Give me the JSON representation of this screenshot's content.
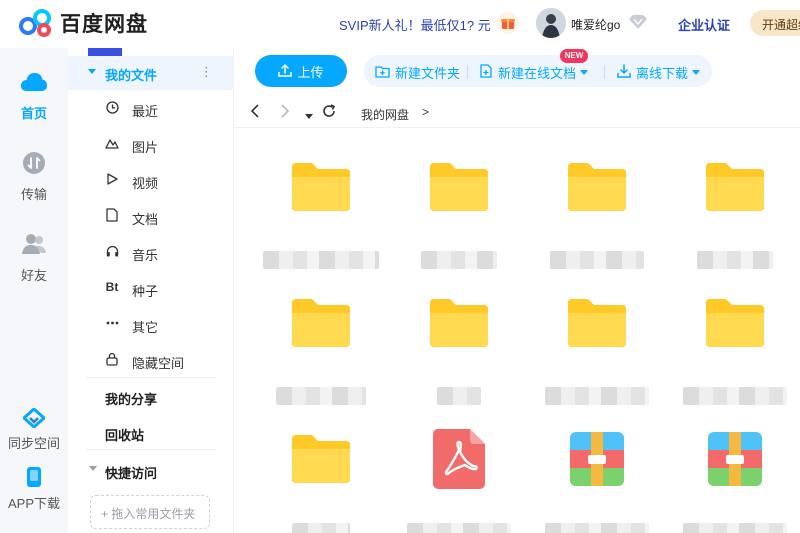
{
  "app": {
    "title": "百度网盘"
  },
  "topbar": {
    "promo": "SVIP新人礼！最低仅1? 元",
    "username": "唯爱纶go",
    "enterprise": "企业认证",
    "svip_button": "开通超级"
  },
  "rail": {
    "items": [
      {
        "label": "首页",
        "icon": "cloud-icon",
        "active": true
      },
      {
        "label": "传输",
        "icon": "transfer-icon",
        "active": false
      },
      {
        "label": "好友",
        "icon": "friends-icon",
        "active": false
      },
      {
        "label": "同步空间",
        "icon": "sync-icon",
        "active": false
      },
      {
        "label": "APP下载",
        "icon": "phone-icon",
        "active": false
      }
    ]
  },
  "sidebar": {
    "my_files": "我的文件",
    "items": [
      {
        "label": "最近",
        "icon": "clock-icon"
      },
      {
        "label": "图片",
        "icon": "image-icon"
      },
      {
        "label": "视频",
        "icon": "play-icon"
      },
      {
        "label": "文档",
        "icon": "document-icon"
      },
      {
        "label": "音乐",
        "icon": "headphones-icon"
      },
      {
        "label": "种子",
        "icon": "bt-icon",
        "glyph": "Bt"
      },
      {
        "label": "其它",
        "icon": "more-icon"
      },
      {
        "label": "隐藏空间",
        "icon": "lock-icon"
      }
    ],
    "my_share": "我的分享",
    "recycle": "回收站",
    "quick_access": "快捷访问",
    "drop_hint": "+ 拖入常用文件夹"
  },
  "toolbar": {
    "upload": "上传",
    "new_folder": "新建文件夹",
    "new_online_doc": "新建在线文档",
    "new_badge": "NEW",
    "offline_download": "离线下载"
  },
  "nav": {
    "breadcrumb": "我的网盘",
    "separator": ">"
  },
  "colors": {
    "accent": "#06a7ff",
    "folder": "#ffd147",
    "pdf": "#f26b6b",
    "badge": "#f5355b"
  },
  "files": [
    {
      "type": "folder"
    },
    {
      "type": "folder"
    },
    {
      "type": "folder"
    },
    {
      "type": "folder"
    },
    {
      "type": "folder"
    },
    {
      "type": "folder"
    },
    {
      "type": "folder"
    },
    {
      "type": "folder"
    },
    {
      "type": "folder"
    },
    {
      "type": "pdf"
    },
    {
      "type": "archive"
    },
    {
      "type": "archive"
    }
  ]
}
